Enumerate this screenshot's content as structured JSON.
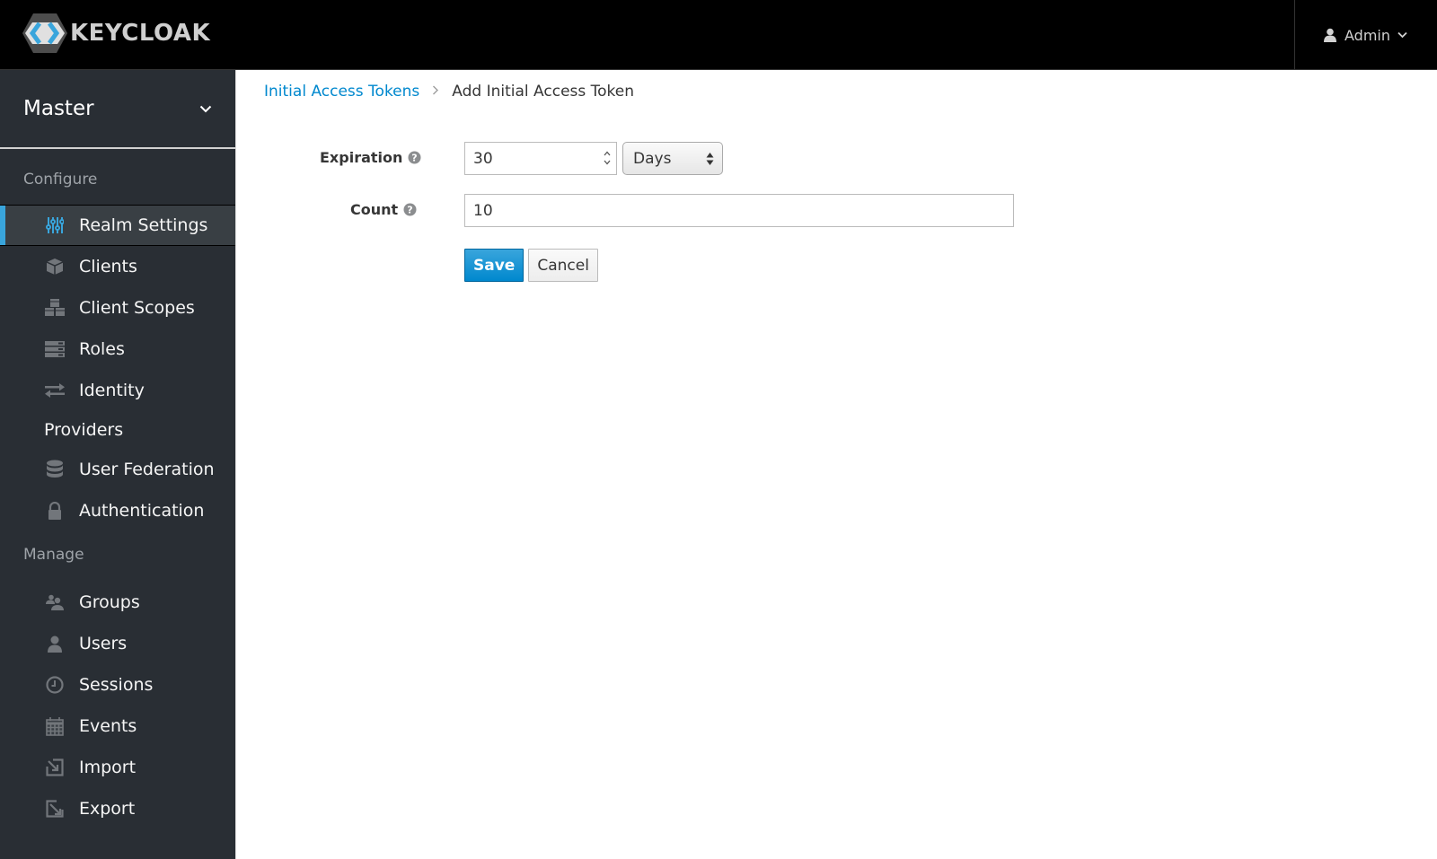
{
  "header": {
    "logo_text": "KEYCLOAK",
    "user_label": "Admin"
  },
  "sidebar": {
    "realm": "Master",
    "configure_label": "Configure",
    "configure_items": [
      {
        "label": "Realm Settings",
        "icon": "sliders-icon",
        "active": true
      },
      {
        "label": "Clients",
        "icon": "cube-icon"
      },
      {
        "label": "Client Scopes",
        "icon": "cubes-icon"
      },
      {
        "label": "Roles",
        "icon": "server-icon"
      },
      {
        "label": "Identity",
        "icon": "exchange-icon"
      },
      {
        "label": "Providers"
      },
      {
        "label": "User Federation",
        "icon": "database-icon"
      },
      {
        "label": "Authentication",
        "icon": "lock-icon"
      }
    ],
    "manage_label": "Manage",
    "manage_items": [
      {
        "label": "Groups",
        "icon": "users-icon"
      },
      {
        "label": "Users",
        "icon": "user-icon"
      },
      {
        "label": "Sessions",
        "icon": "clock-icon"
      },
      {
        "label": "Events",
        "icon": "calendar-icon"
      },
      {
        "label": "Import",
        "icon": "import-icon"
      },
      {
        "label": "Export",
        "icon": "export-icon"
      }
    ]
  },
  "breadcrumb": {
    "parent": "Initial Access Tokens",
    "current": "Add Initial Access Token"
  },
  "form": {
    "expiration_label": "Expiration",
    "expiration_value": "30",
    "expiration_unit": "Days",
    "count_label": "Count",
    "count_value": "10",
    "save_label": "Save",
    "cancel_label": "Cancel"
  },
  "colors": {
    "accent": "#39a5dc",
    "link": "#0088ce",
    "sidebar_bg": "#292e34",
    "topbar_bg": "#000000"
  }
}
